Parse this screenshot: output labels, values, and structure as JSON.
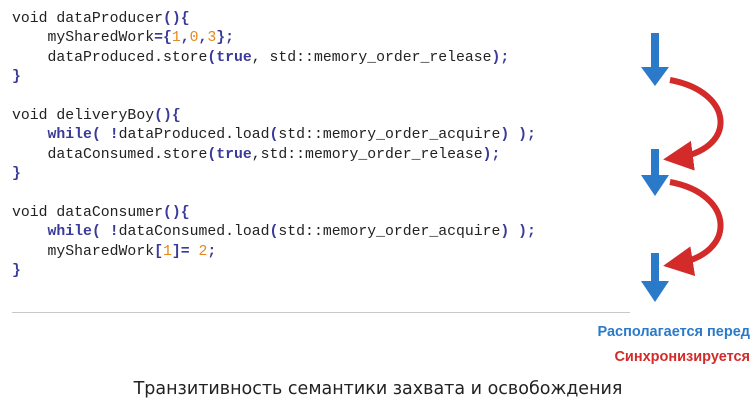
{
  "code_lines": [
    [
      {
        "t": "void dataProducer",
        "c": "t"
      },
      {
        "t": "(){",
        "c": "p"
      }
    ],
    [
      {
        "t": "    mySharedWork",
        "c": "t"
      },
      {
        "t": "={",
        "c": "p"
      },
      {
        "t": "1",
        "c": "n"
      },
      {
        "t": ",",
        "c": "p"
      },
      {
        "t": "0",
        "c": "n"
      },
      {
        "t": ",",
        "c": "p"
      },
      {
        "t": "3",
        "c": "n"
      },
      {
        "t": "};",
        "c": "p"
      }
    ],
    [
      {
        "t": "    dataProduced.store",
        "c": "t"
      },
      {
        "t": "(",
        "c": "p"
      },
      {
        "t": "true",
        "c": "k"
      },
      {
        "t": ", std::memory_order_release",
        "c": "t"
      },
      {
        "t": ");",
        "c": "p"
      }
    ],
    [
      {
        "t": "}",
        "c": "p"
      }
    ],
    [
      {
        "t": "",
        "c": "t"
      }
    ],
    [
      {
        "t": "void deliveryBoy",
        "c": "t"
      },
      {
        "t": "(){",
        "c": "p"
      }
    ],
    [
      {
        "t": "    ",
        "c": "t"
      },
      {
        "t": "while",
        "c": "k"
      },
      {
        "t": "( !",
        "c": "p"
      },
      {
        "t": "dataProduced.load",
        "c": "t"
      },
      {
        "t": "(",
        "c": "p"
      },
      {
        "t": "std::memory_order_acquire",
        "c": "t"
      },
      {
        "t": ") );",
        "c": "p"
      }
    ],
    [
      {
        "t": "    dataConsumed.store",
        "c": "t"
      },
      {
        "t": "(",
        "c": "p"
      },
      {
        "t": "true",
        "c": "k"
      },
      {
        "t": ",std::memory_order_release",
        "c": "t"
      },
      {
        "t": ");",
        "c": "p"
      }
    ],
    [
      {
        "t": "}",
        "c": "p"
      }
    ],
    [
      {
        "t": "",
        "c": "t"
      }
    ],
    [
      {
        "t": "void dataConsumer",
        "c": "t"
      },
      {
        "t": "(){",
        "c": "p"
      }
    ],
    [
      {
        "t": "    ",
        "c": "t"
      },
      {
        "t": "while",
        "c": "k"
      },
      {
        "t": "( !",
        "c": "p"
      },
      {
        "t": "dataConsumed.load",
        "c": "t"
      },
      {
        "t": "(",
        "c": "p"
      },
      {
        "t": "std::memory_order_acquire",
        "c": "t"
      },
      {
        "t": ") );",
        "c": "p"
      }
    ],
    [
      {
        "t": "    mySharedWork",
        "c": "t"
      },
      {
        "t": "[",
        "c": "p"
      },
      {
        "t": "1",
        "c": "n"
      },
      {
        "t": "]= ",
        "c": "p"
      },
      {
        "t": "2",
        "c": "n"
      },
      {
        "t": ";",
        "c": "p"
      }
    ],
    [
      {
        "t": "}",
        "c": "p"
      }
    ]
  ],
  "legend": {
    "before_label": "Располагается перед",
    "sync_label": "Синхронизируется",
    "before_color": "#2a7ac9",
    "sync_color": "#d32a2a"
  },
  "caption": "Транзитивность семантики захвата и освобождения"
}
